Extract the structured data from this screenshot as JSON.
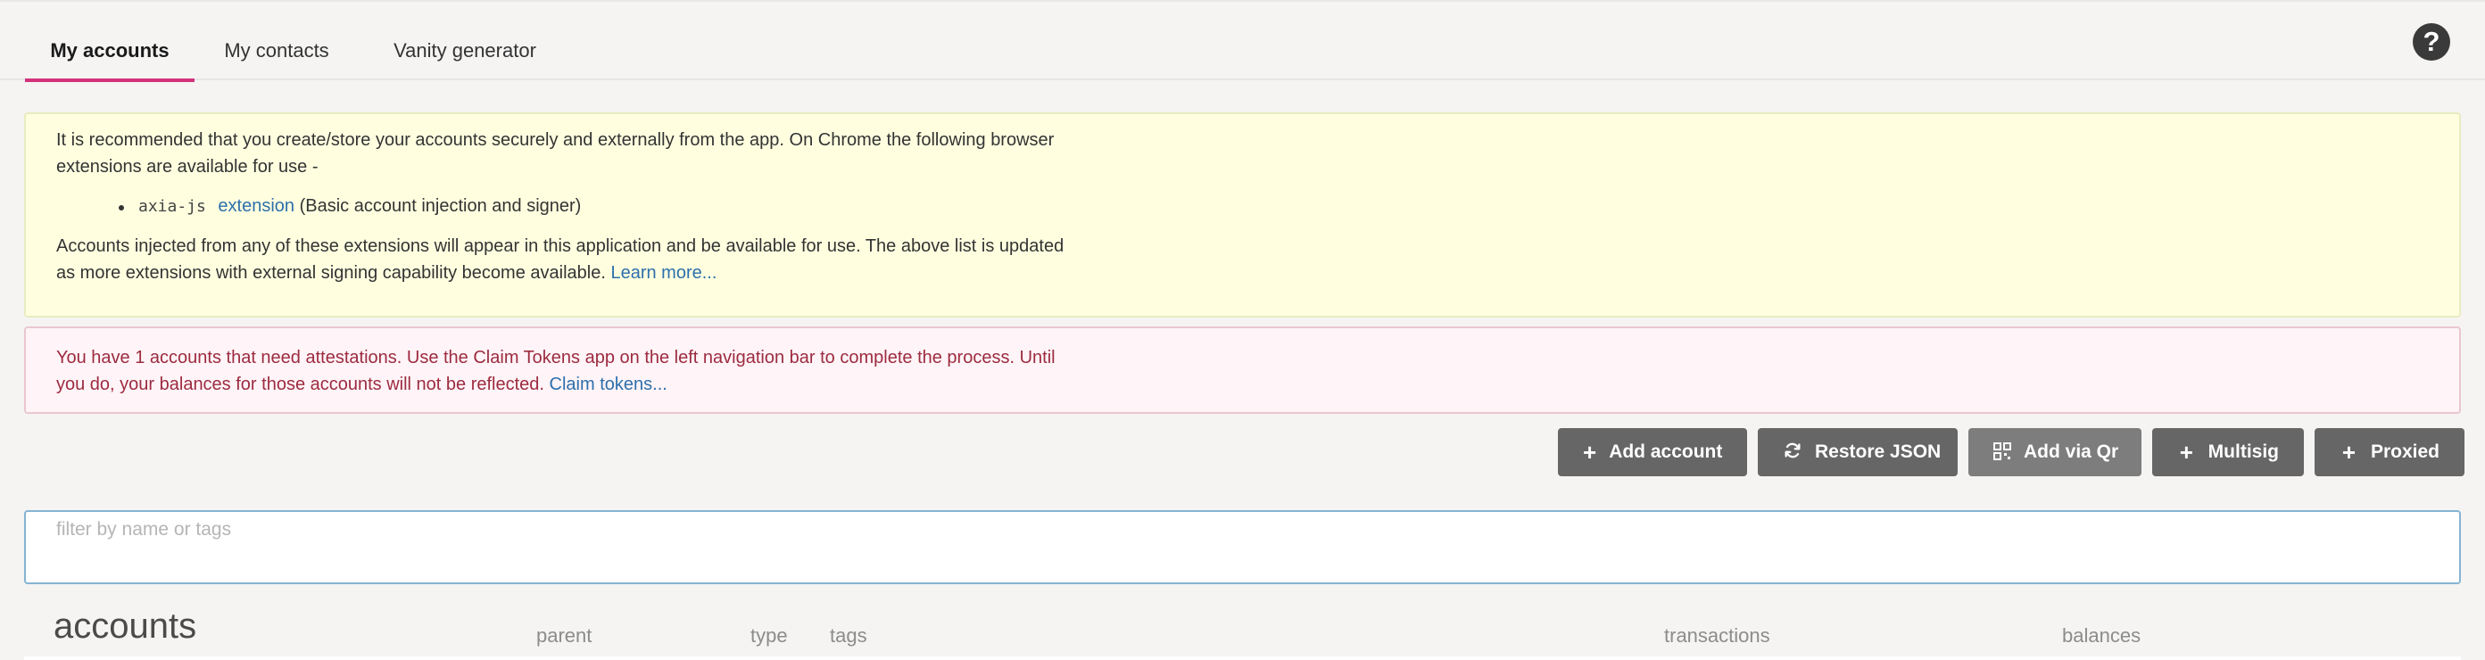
{
  "tabs": [
    {
      "label": "My accounts",
      "active": true
    },
    {
      "label": "My contacts",
      "active": false
    },
    {
      "label": "Vanity generator",
      "active": false
    }
  ],
  "help": {
    "icon": "question-circle-icon",
    "glyph": "?"
  },
  "info_banner": {
    "intro": "It is recommended that you create/store your accounts securely and externally from the app. On Chrome the following browser extensions are available for use -",
    "extension_code": "axia-js",
    "extension_link": "extension",
    "extension_desc": "(Basic account injection and signer)",
    "outro": "Accounts injected from any of these extensions will appear in this application and be available for use. The above list is updated as more extensions with external signing capability become available.",
    "learn_more": "Learn more..."
  },
  "warning_banner": {
    "text": "You have 1 accounts that need attestations. Use the Claim Tokens app on the left navigation bar to complete the process. Until you do, your balances for those accounts will not be reflected.",
    "link": "Claim tokens..."
  },
  "buttons": [
    {
      "label": "Add account",
      "icon": "plus-icon"
    },
    {
      "label": "Restore JSON",
      "icon": "sync-icon"
    },
    {
      "label": "Add via Qr",
      "icon": "qrcode-icon"
    },
    {
      "label": "Multisig",
      "icon": "plus-icon"
    },
    {
      "label": "Proxied",
      "icon": "plus-icon"
    }
  ],
  "filter": {
    "placeholder": "filter by name or tags",
    "value": ""
  },
  "table": {
    "title": "accounts",
    "columns": [
      "parent",
      "type",
      "tags",
      "transactions",
      "balances"
    ]
  },
  "colors": {
    "accent": "#d4317a",
    "info_bg": "#ffffe0",
    "warn_bg": "#fff4f7",
    "warn_text": "#9c2b40",
    "link": "#2d6fab",
    "button": "#666666"
  }
}
